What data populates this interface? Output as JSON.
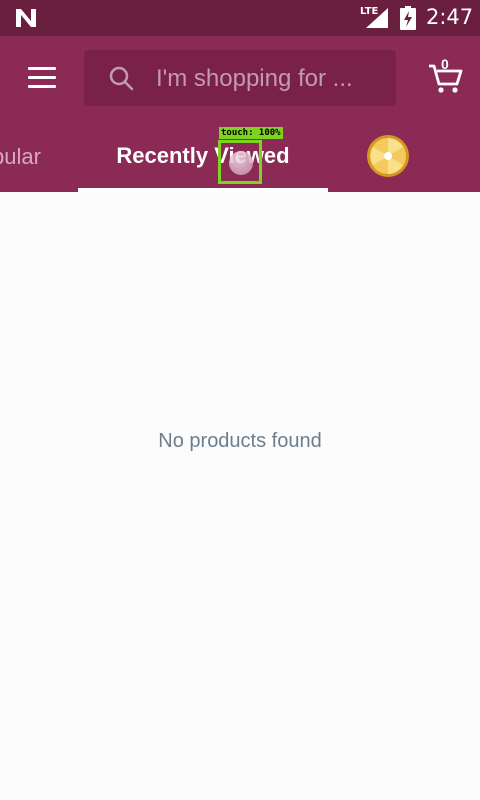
{
  "status_bar": {
    "network": "LTE",
    "time": "2:47"
  },
  "search": {
    "placeholder": "I'm shopping for ..."
  },
  "cart": {
    "count": "0"
  },
  "tabs": [
    {
      "label": "Popular",
      "visible_text": "pular",
      "selected": false
    },
    {
      "label": "Recently Viewed",
      "selected": true
    }
  ],
  "touch_overlay": {
    "label": "touch: 100%"
  },
  "main": {
    "empty_message": "No products found"
  },
  "colors": {
    "status_bar": "#6a1f3f",
    "app_bar": "#8a2a55",
    "search_box": "#7a2149",
    "empty_text": "#6b7e8c",
    "touch_overlay": "#7ed321"
  },
  "icons": [
    "android-n-icon",
    "signal-icon",
    "battery-icon",
    "menu-icon",
    "search-icon",
    "cart-icon",
    "coin-icon"
  ]
}
